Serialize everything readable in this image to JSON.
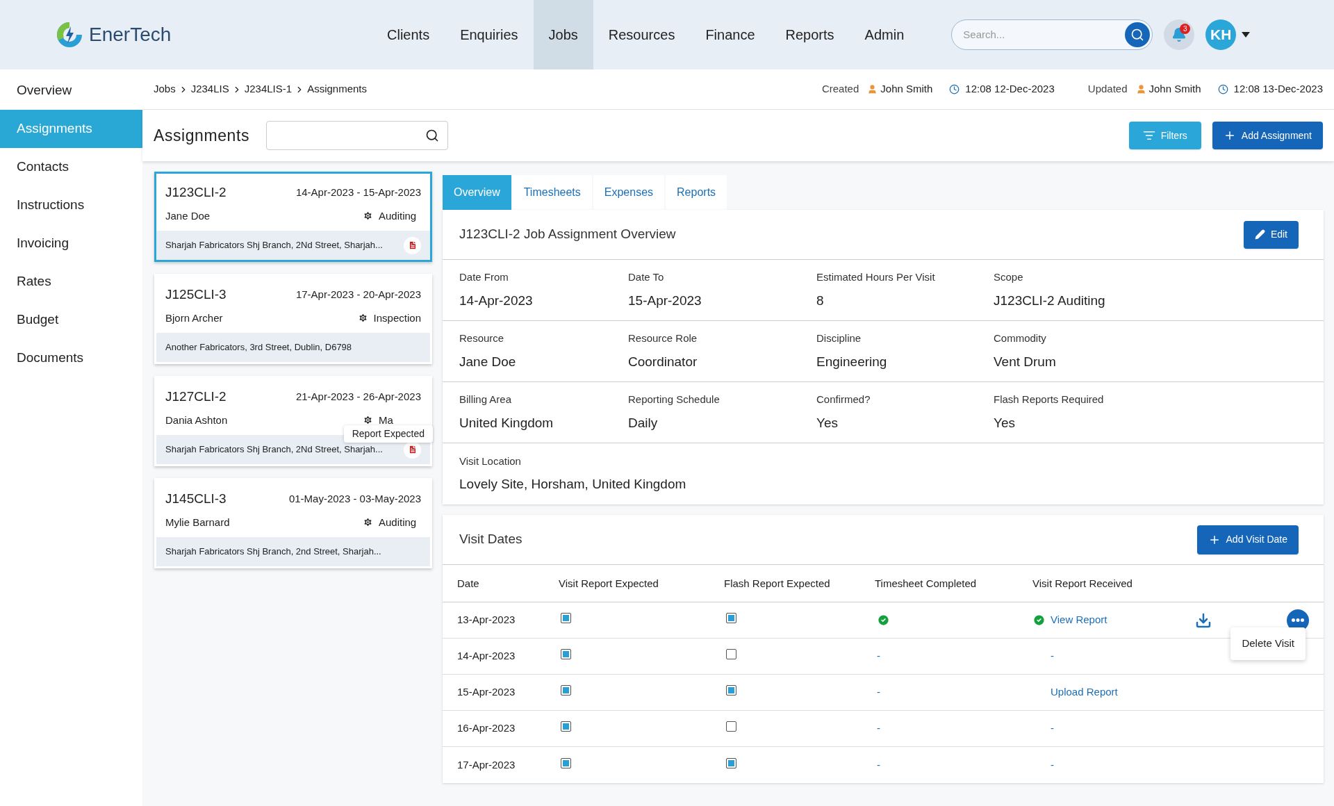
{
  "brand": {
    "name": "EnerTech"
  },
  "nav": [
    {
      "label": "Clients",
      "selected": false
    },
    {
      "label": "Enquiries",
      "selected": false
    },
    {
      "label": "Jobs",
      "selected": true
    },
    {
      "label": "Resources",
      "selected": false
    },
    {
      "label": "Finance",
      "selected": false
    },
    {
      "label": "Reports",
      "selected": false
    },
    {
      "label": "Admin",
      "selected": false
    }
  ],
  "search": {
    "placeholder": "Search..."
  },
  "notifications": {
    "count": "3"
  },
  "user": {
    "initials": "KH"
  },
  "sidebar": {
    "items": [
      {
        "label": "Overview",
        "selected": false
      },
      {
        "label": "Assignments",
        "selected": true
      },
      {
        "label": "Contacts",
        "selected": false
      },
      {
        "label": "Instructions",
        "selected": false
      },
      {
        "label": "Invoicing",
        "selected": false
      },
      {
        "label": "Rates",
        "selected": false
      },
      {
        "label": "Budget",
        "selected": false
      },
      {
        "label": "Documents",
        "selected": false
      }
    ]
  },
  "breadcrumb": [
    "Jobs",
    "J234LIS",
    "J234LIS-1",
    "Assignments"
  ],
  "audit": {
    "created_label": "Created",
    "created_by": "John Smith",
    "created_at": "12:08 12-Dec-2023",
    "updated_label": "Updated",
    "updated_by": "John Smith",
    "updated_at": "12:08 13-Dec-2023"
  },
  "page": {
    "title": "Assignments",
    "filters_button": "Filters",
    "add_button": "Add Assignment"
  },
  "cards": [
    {
      "id": "J123CLI-2",
      "dates": "14-Apr-2023 - 15-Apr-2023",
      "name": "Jane Doe",
      "scope": "Auditing",
      "address": "Sharjah Fabricators Shj Branch, 2Nd Street, Sharjah...",
      "selected": true,
      "report_expected": true
    },
    {
      "id": "J125CLI-3",
      "dates": "17-Apr-2023 - 20-Apr-2023",
      "name": "Bjorn Archer",
      "scope": "Inspection",
      "address": "Another Fabricators, 3rd Street, Dublin, D6798",
      "selected": false,
      "report_expected": false
    },
    {
      "id": "J127CLI-2",
      "dates": "21-Apr-2023 - 26-Apr-2023",
      "name": "Dania Ashton",
      "scope": "Ma",
      "address": "Sharjah Fabricators Shj Branch, 2Nd Street, Sharjah...",
      "selected": false,
      "report_expected": true,
      "tooltip": "Report Expected"
    },
    {
      "id": "J145CLI-3",
      "dates": "01-May-2023 - 03-May-2023",
      "name": "Mylie Barnard",
      "scope": "Auditing",
      "address": "Sharjah Fabricators Shj Branch, 2nd Street, Sharjah...",
      "selected": false,
      "report_expected": false
    }
  ],
  "tabs": [
    {
      "label": "Overview",
      "selected": true
    },
    {
      "label": "Timesheets",
      "selected": false
    },
    {
      "label": "Expenses",
      "selected": false
    },
    {
      "label": "Reports",
      "selected": false
    }
  ],
  "overview": {
    "title": "J123CLI-2 Job Assignment Overview",
    "edit_button": "Edit",
    "rows": [
      [
        {
          "label": "Date From",
          "value": "14-Apr-2023"
        },
        {
          "label": "Date To",
          "value": "15-Apr-2023"
        },
        {
          "label": "Estimated Hours Per Visit",
          "value": "8"
        },
        {
          "label": "Scope",
          "value": "J123CLI-2 Auditing"
        }
      ],
      [
        {
          "label": "Resource",
          "value": "Jane Doe"
        },
        {
          "label": "Resource Role",
          "value": "Coordinator"
        },
        {
          "label": "Discipline",
          "value": "Engineering"
        },
        {
          "label": "Commodity",
          "value": "Vent Drum"
        }
      ],
      [
        {
          "label": "Billing Area",
          "value": "United Kingdom"
        },
        {
          "label": "Reporting Schedule",
          "value": "Daily"
        },
        {
          "label": "Confirmed?",
          "value": "Yes"
        },
        {
          "label": "Flash Reports Required",
          "value": "Yes"
        }
      ],
      [
        {
          "label": "Visit Location",
          "value": "Lovely Site, Horsham, United Kingdom"
        }
      ]
    ]
  },
  "visit_dates": {
    "title": "Visit Dates",
    "add_button": "Add Visit Date",
    "columns": [
      "Date",
      "Visit Report Expected",
      "Flash Report Expected",
      "Timesheet Completed",
      "Visit Report Received"
    ],
    "rows": [
      {
        "date": "13-Apr-2023",
        "visit_expected": true,
        "flash_expected": true,
        "timesheet_completed": true,
        "timesheet": "",
        "received": true,
        "report": "View Report",
        "download": true,
        "menu": [
          "Delete Visit"
        ]
      },
      {
        "date": "14-Apr-2023",
        "visit_expected": true,
        "flash_expected": false,
        "timesheet_completed": false,
        "timesheet": "-",
        "received": false,
        "report": "-",
        "download": false
      },
      {
        "date": "15-Apr-2023",
        "visit_expected": true,
        "flash_expected": true,
        "timesheet_completed": false,
        "timesheet": "-",
        "received": false,
        "report": "Upload Report",
        "download": false
      },
      {
        "date": "16-Apr-2023",
        "visit_expected": true,
        "flash_expected": false,
        "timesheet_completed": false,
        "timesheet": "-",
        "received": false,
        "report": "-",
        "download": false
      },
      {
        "date": "17-Apr-2023",
        "visit_expected": true,
        "flash_expected": true,
        "timesheet_completed": false,
        "timesheet": "-",
        "received": false,
        "report": "-",
        "download": false
      }
    ]
  }
}
